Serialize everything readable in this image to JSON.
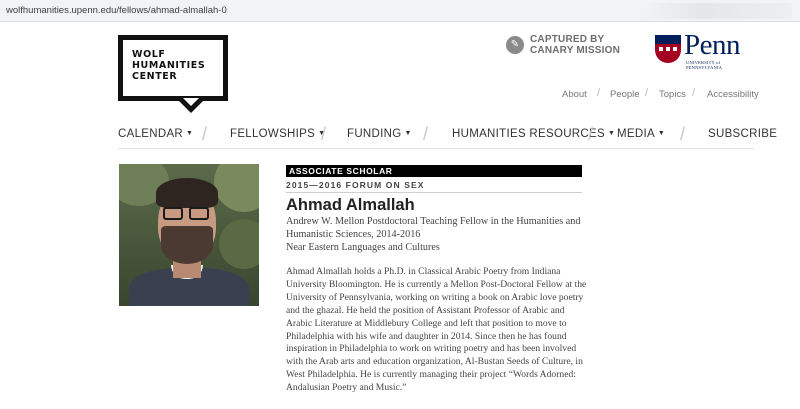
{
  "browser": {
    "url": "wolfhumanities.upenn.edu/fellows/ahmad-almallah-0"
  },
  "logo": {
    "line1": "WOLF",
    "line2": "HUMANITIES",
    "line3": "CENTER"
  },
  "canary": {
    "line1": "CAPTURED BY",
    "line2": "CANARY MISSION"
  },
  "penn": {
    "wordmark": "Penn",
    "subtitle": "UNIVERSITY of PENNSYLVANIA"
  },
  "utility_nav": [
    "About",
    "People",
    "Topics",
    "Accessibility"
  ],
  "utility_sep": "/",
  "main_nav": {
    "calendar": "CALENDAR",
    "fellowships": "FELLOWSHIPS",
    "funding": "FUNDING",
    "humanities": "HUMANITIES RESOURCES",
    "media": "MEDIA",
    "subscribe": "SUBSCRIBE",
    "caret": "▼",
    "sep": "/"
  },
  "profile": {
    "badge": "ASSOCIATE SCHOLAR",
    "forum": "2015—2016 FORUM ON SEX",
    "name": "Ahmad Almallah",
    "title": "Andrew W. Mellon Postdoctoral Teaching Fellow in the Humanities and Humanistic Sciences, 2014-2016",
    "department": "Near Eastern Languages and Cultures",
    "bio": "Ahmad Almallah holds a Ph.D. in Classical Arabic Poetry from Indiana University Bloomington. He is currently a Mellon Post-Doctoral Fellow at the University of Pennsylvania, working on writing a book on Arabic love poetry and the ghazal. He held the position of Assistant Professor of Arabic and Arabic Literature at Middlebury College and left that position to move to Philadelphia with his wife and daughter in 2014. Since then he has found inspiration in Philadelphia to work on writing poetry and has been involved with the Arab arts and education organization, Al-Bustan Seeds of Culture, in West Philadelphia. He is currently managing their project “Words Adorned: Andalusian Poetry and Music.”"
  },
  "colors": {
    "penn_blue": "#011f5b",
    "penn_red": "#a50021",
    "badge_bg": "#000000"
  }
}
